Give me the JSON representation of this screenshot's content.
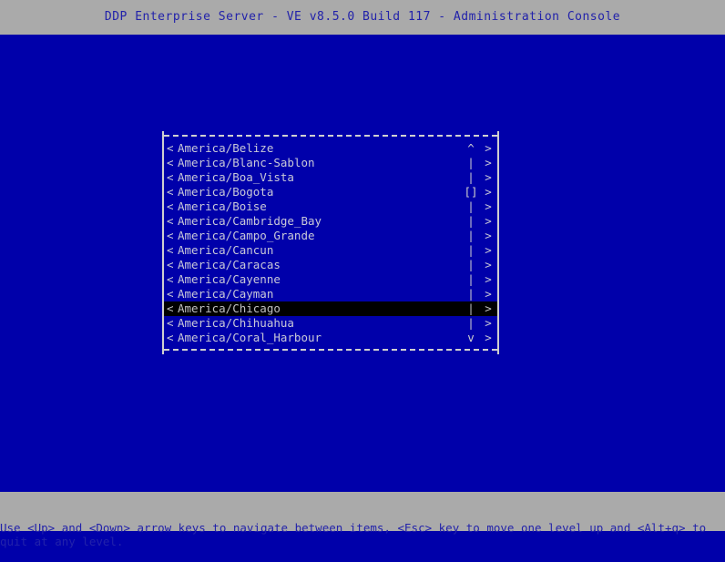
{
  "window": {
    "title": "DDP Enterprise Server - VE v8.5.0 Build 117 - Administration Console"
  },
  "theme": {
    "background": "#0000aa",
    "bar_background": "#aaaaaa",
    "bar_text": "#2222aa",
    "list_text": "#c9c9d8",
    "border": "#cfcfcf",
    "selected_background": "#000000",
    "selected_text": "#c0c0c0"
  },
  "dialog": {
    "left_marker": "<",
    "right_marker": ">",
    "scroll": {
      "up_arrow": "^",
      "down_arrow": "v",
      "track": "|",
      "thumb": "[]",
      "thumb_row_index": 3
    },
    "items": [
      {
        "label": "America/Belize",
        "scroll": "^",
        "selected": false
      },
      {
        "label": "America/Blanc-Sablon",
        "scroll": "|",
        "selected": false
      },
      {
        "label": "America/Boa_Vista",
        "scroll": "|",
        "selected": false
      },
      {
        "label": "America/Bogota",
        "scroll": "[]",
        "selected": false
      },
      {
        "label": "America/Boise",
        "scroll": "|",
        "selected": false
      },
      {
        "label": "America/Cambridge_Bay",
        "scroll": "|",
        "selected": false
      },
      {
        "label": "America/Campo_Grande",
        "scroll": "|",
        "selected": false
      },
      {
        "label": "America/Cancun",
        "scroll": "|",
        "selected": false
      },
      {
        "label": "America/Caracas",
        "scroll": "|",
        "selected": false
      },
      {
        "label": "America/Cayenne",
        "scroll": "|",
        "selected": false
      },
      {
        "label": "America/Cayman",
        "scroll": "|",
        "selected": false
      },
      {
        "label": "America/Chicago",
        "scroll": "|",
        "selected": true
      },
      {
        "label": "America/Chihuahua",
        "scroll": "|",
        "selected": false
      },
      {
        "label": "America/Coral_Harbour",
        "scroll": "v",
        "selected": false
      }
    ]
  },
  "status": {
    "text": "Use <Up> and <Down> arrow keys to navigate between items, <Esc> key to move one level up and <Alt+q> to quit at any level."
  }
}
